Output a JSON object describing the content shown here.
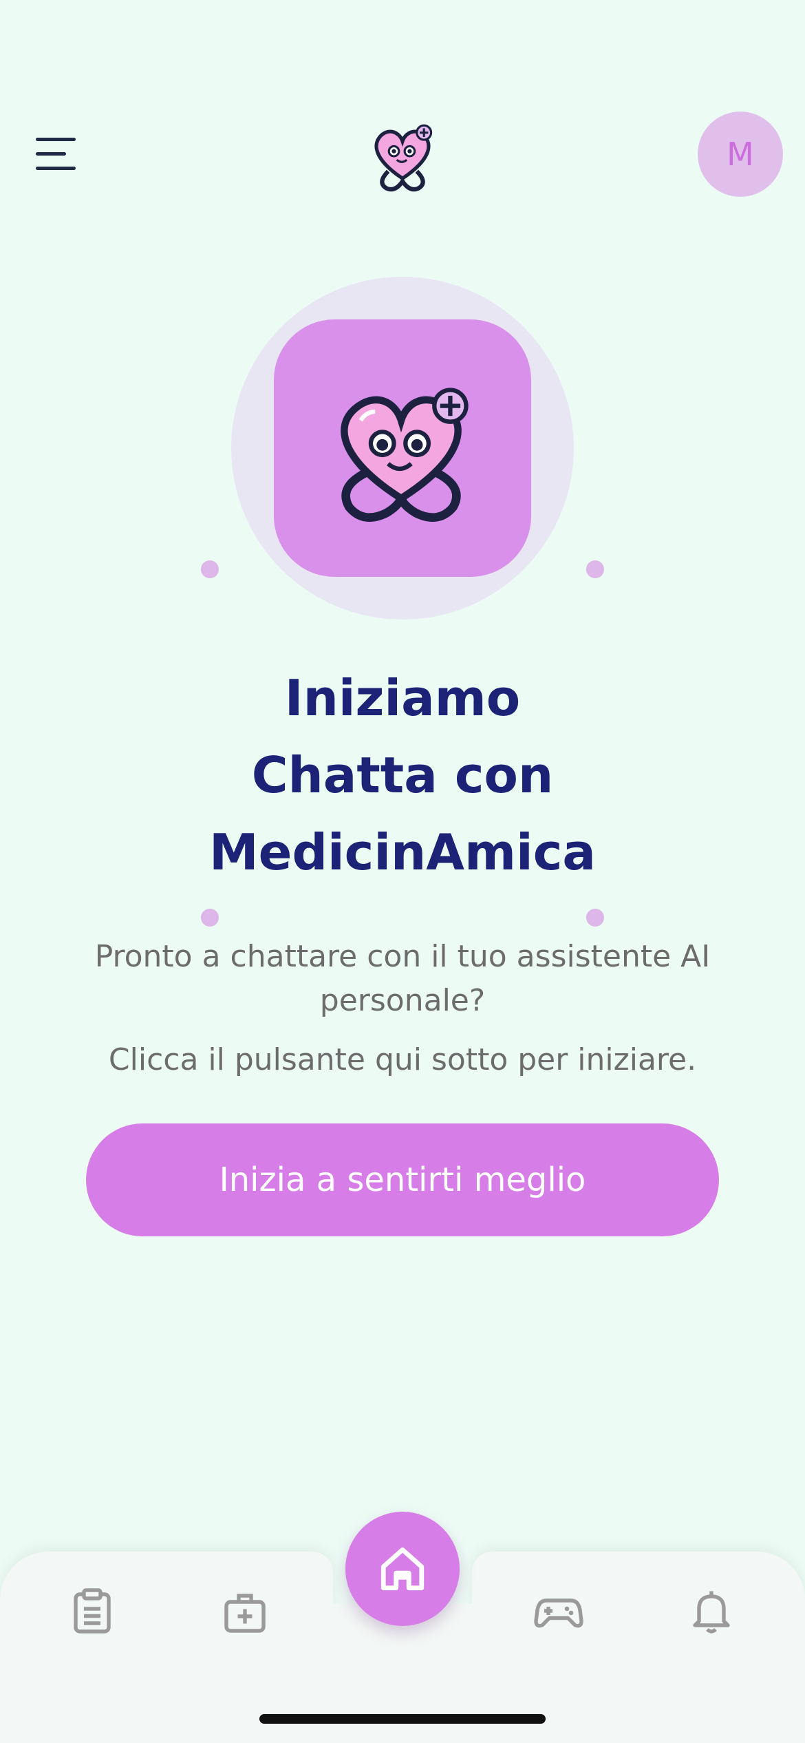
{
  "header": {
    "menu_icon": "hamburger-menu-icon",
    "logo_icon": "heart-stethoscope-logo",
    "avatar_initial": "M"
  },
  "hero": {
    "logo_icon": "heart-stethoscope-mascot",
    "title_lines": [
      "Iniziamo",
      "Chatta con",
      "MedicinAmica"
    ],
    "subtitle": "Pronto a chattare con il tuo assistente AI personale?",
    "subtitle2": "Clicca il pulsante qui sotto per iniziare.",
    "cta_label": "Inizia a sentirti meglio"
  },
  "bottom_nav": {
    "items": [
      {
        "icon": "clipboard-icon"
      },
      {
        "icon": "medical-kit-icon"
      },
      {
        "icon": "home-icon",
        "active": true
      },
      {
        "icon": "gamepad-icon"
      },
      {
        "icon": "bell-icon"
      }
    ]
  },
  "colors": {
    "background": "#edfbf5",
    "accent": "#d67de8",
    "title": "#1c2275",
    "text": "#6c6c6c"
  }
}
